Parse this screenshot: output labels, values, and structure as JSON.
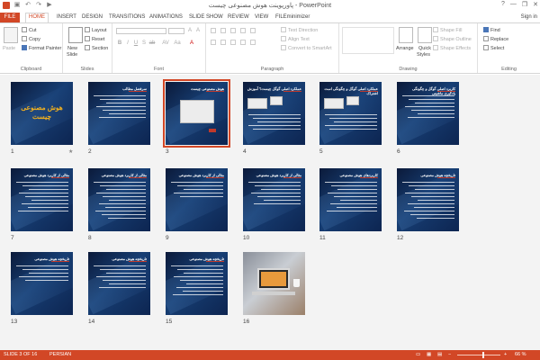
{
  "window": {
    "title": "پاورپوینت هوش مصنوعی چیست - PowerPoint",
    "controls": [
      "?",
      "—",
      "❐",
      "✕"
    ]
  },
  "tabs": [
    "FILE",
    "HOME",
    "INSERT",
    "DESIGN",
    "TRANSITIONS",
    "ANIMATIONS",
    "SLIDE SHOW",
    "REVIEW",
    "VIEW",
    "FILEminimizer"
  ],
  "account": {
    "sign_in": "Sign in"
  },
  "ribbon": {
    "clipboard": {
      "paste": "Paste",
      "cut": "Cut",
      "copy": "Copy",
      "format_painter": "Format Painter",
      "label": "Clipboard"
    },
    "slides": {
      "new_slide_line1": "New",
      "new_slide_line2": "Slide",
      "layout": "Layout",
      "reset": "Reset",
      "section": "Section",
      "label": "Slides"
    },
    "font": {
      "label": "Font"
    },
    "paragraph": {
      "text_direction": "Text Direction",
      "align_text": "Align Text",
      "convert": "Convert to SmartArt",
      "label": "Paragraph"
    },
    "drawing": {
      "arrange": "Arrange",
      "quick_styles_line1": "Quick",
      "quick_styles_line2": "Styles",
      "shape_fill": "Shape Fill",
      "shape_outline": "Shape Outline",
      "shape_effects": "Shape Effects",
      "label": "Drawing"
    },
    "editing": {
      "find": "Find",
      "replace": "Replace",
      "select": "Select",
      "label": "Editing"
    }
  },
  "slides": [
    {
      "num": "1",
      "title": "هوش مصنوعی چیست",
      "kind": "cover",
      "star": "★"
    },
    {
      "num": "2",
      "title": "سرفصل مطالب",
      "kind": "text"
    },
    {
      "num": "3",
      "title": "هوش مصنوعی چیست",
      "kind": "diagram",
      "selected": true
    },
    {
      "num": "4",
      "title": "عملکرد اصلی گوگل چیست؟ آموزش",
      "kind": "boxes"
    },
    {
      "num": "5",
      "title": "عملکرد اصلی گوگل و چگونگی است اشتراک",
      "kind": "boxes"
    },
    {
      "num": "6",
      "title": "کاربرد اصلی گوگل و چگونگی یادگیری ماشینی",
      "kind": "text"
    },
    {
      "num": "7",
      "title": "مثالی از کاربرد هوش مصنوعی",
      "kind": "text"
    },
    {
      "num": "8",
      "title": "مثالی از کاربرد هوش مصنوعی",
      "kind": "text"
    },
    {
      "num": "9",
      "title": "مثالی از کاربرد هوش مصنوعی",
      "kind": "text"
    },
    {
      "num": "10",
      "title": "مثالی از کاربرد هوش مصنوعی",
      "kind": "text"
    },
    {
      "num": "11",
      "title": "کاربردهای هوش مصنوعی",
      "kind": "text"
    },
    {
      "num": "12",
      "title": "تاریخچه هوش مصنوعی",
      "kind": "text"
    },
    {
      "num": "13",
      "title": "تاریخچه هوش مصنوعی",
      "kind": "text"
    },
    {
      "num": "14",
      "title": "تاریخچه هوش مصنوعی",
      "kind": "text"
    },
    {
      "num": "15",
      "title": "تاریخچه هوش مصنوعی",
      "kind": "text"
    },
    {
      "num": "16",
      "title": "",
      "kind": "photo"
    }
  ],
  "status": {
    "slide_of": "SLIDE 3 OF 16",
    "language": "PERSIAN",
    "zoom": "66 %"
  },
  "colors": {
    "accent": "#d24726",
    "slide_bg": "#173e73",
    "cover_title": "#f0b020"
  }
}
